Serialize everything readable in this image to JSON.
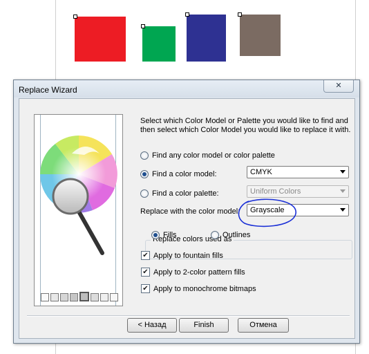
{
  "canvas": {
    "swatches": [
      {
        "name": "red",
        "color": "#ed1c24"
      },
      {
        "name": "green",
        "color": "#00a651"
      },
      {
        "name": "navy",
        "color": "#2e3192"
      },
      {
        "name": "taupe",
        "color": "#7b6b62"
      }
    ]
  },
  "dialog": {
    "title": "Replace Wizard",
    "close_icon": "close-icon",
    "instructions": "Select which Color Model or Palette you would like to find and then select which Color Model you would like to replace it with.",
    "options": {
      "any_label": "Find any color model or color palette",
      "model_label": "Find a color model:",
      "model_value": "CMYK",
      "palette_label": "Find a color palette:",
      "palette_value": "Uniform Colors",
      "replace_label": "Replace with the color model:",
      "replace_value": "Grayscale"
    },
    "group": {
      "title": "Replace colors used as",
      "fills": "Fills",
      "outlines": "Outlines"
    },
    "checks": {
      "fountain": "Apply to fountain fills",
      "pattern": "Apply to 2-color pattern fills",
      "mono": "Apply to monochrome bitmaps",
      "check_glyph": "✔"
    },
    "buttons": {
      "back": "< Назад",
      "finish": "Finish",
      "cancel": "Отмена"
    },
    "annotation_color": "#1a2fd6"
  }
}
